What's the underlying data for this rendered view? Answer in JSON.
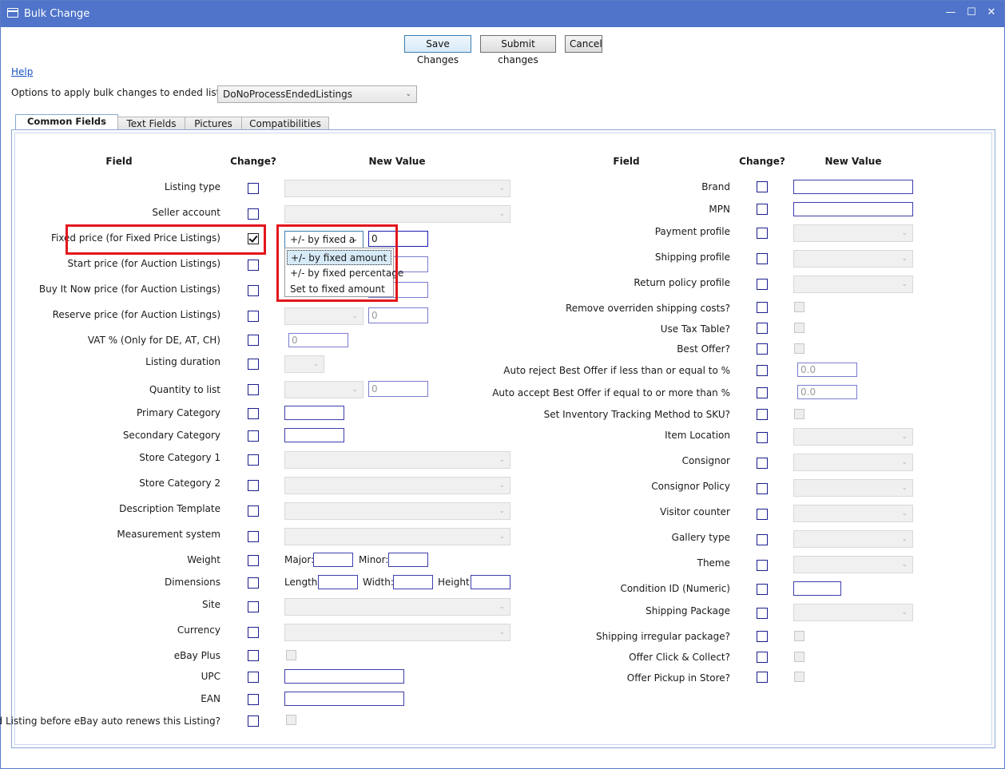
{
  "window": {
    "title": "Bulk Change",
    "minimize": "—",
    "maximize": "☐",
    "close": "✕"
  },
  "toolbar": {
    "save_label": "Save Changes",
    "submit_label": "Submit changes",
    "cancel_label": "Cancel"
  },
  "help_link": "Help",
  "ended_options": {
    "label": "Options to apply bulk changes to ended listings:",
    "value": "DoNoProcessEndedListings"
  },
  "tabs": [
    "Common Fields",
    "Text Fields",
    "Pictures",
    "Compatibilities"
  ],
  "headers": {
    "field": "Field",
    "change": "Change?",
    "new_value": "New Value"
  },
  "left_fields": [
    "Listing type",
    "Seller account",
    "Fixed price (for Fixed Price Listings)",
    "Start price (for Auction Listings)",
    "Buy It Now price (for Auction Listings)",
    "Reserve price (for Auction Listings)",
    "VAT % (Only for DE, AT, CH)",
    "Listing duration",
    "Quantity to list",
    "Primary Category",
    "Secondary Category",
    "Store Category 1",
    "Store Category 2",
    "Description Template",
    "Measurement system",
    "Weight",
    "Dimensions",
    "Site",
    "Currency",
    "eBay Plus",
    "UPC",
    "EAN",
    "End Listing before eBay auto renews this Listing?"
  ],
  "right_fields": [
    "Brand",
    "MPN",
    "Payment profile",
    "Shipping profile",
    "Return policy profile",
    "Remove overriden shipping costs?",
    "Use Tax Table?",
    "Best Offer?",
    "Auto reject Best Offer if less than or equal to %",
    "Auto accept Best Offer if equal to or more than %",
    "Set Inventory Tracking Method to SKU?",
    "Item Location",
    "Consignor",
    "Consignor Policy",
    "Visitor counter",
    "Gallery type",
    "Theme",
    "Condition ID (Numeric)",
    "Shipping Package",
    "Shipping irregular package?",
    "Offer Click & Collect?",
    "Offer Pickup in Store?"
  ],
  "fixed_price": {
    "checked": true,
    "mode_value": "+/- by fixed a",
    "amount": "0",
    "options": [
      "+/- by fixed amount",
      "+/- by fixed percentage",
      "Set to fixed amount"
    ],
    "selected_index": 0
  },
  "values": {
    "reserve_amount": "0",
    "vat": "0",
    "quantity": "0",
    "auto_reject": "0.0",
    "auto_accept": "0.0"
  },
  "sublabels": {
    "major": "Major:",
    "minor": "Minor:",
    "length": "Length:",
    "width": "Width:",
    "height": "Height:"
  },
  "colors": {
    "titlebar": "#4f74c9",
    "highlight": "#e3161d",
    "checkbox_border": "#1b1f8c"
  }
}
